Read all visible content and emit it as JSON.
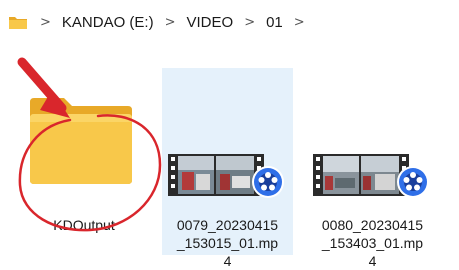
{
  "breadcrumb": {
    "segments": [
      "KANDAO (E:)",
      "VIDEO",
      "01"
    ],
    "separator": ">"
  },
  "files": [
    {
      "name": "KDOutput",
      "kind": "folder",
      "icon": "folder-icon"
    },
    {
      "name": "0079_20230415_153015_01.mp4",
      "line1": "0079_20230415",
      "line2": "_153015_01.mp",
      "line3": "4",
      "kind": "video",
      "icon": "video-player-icon",
      "selected": true
    },
    {
      "name": "0080_20230415_153403_01.mp4",
      "line1": "0080_20230415",
      "line2": "_153403_01.mp",
      "line3": "4",
      "kind": "video",
      "icon": "video-player-icon",
      "selected": false
    }
  ],
  "colors": {
    "folder": "#f8c84a",
    "folder_back": "#e8a928",
    "selection": "#e5f1fb",
    "annotation": "#d9262c",
    "player_badge": "#2f6fe8"
  }
}
